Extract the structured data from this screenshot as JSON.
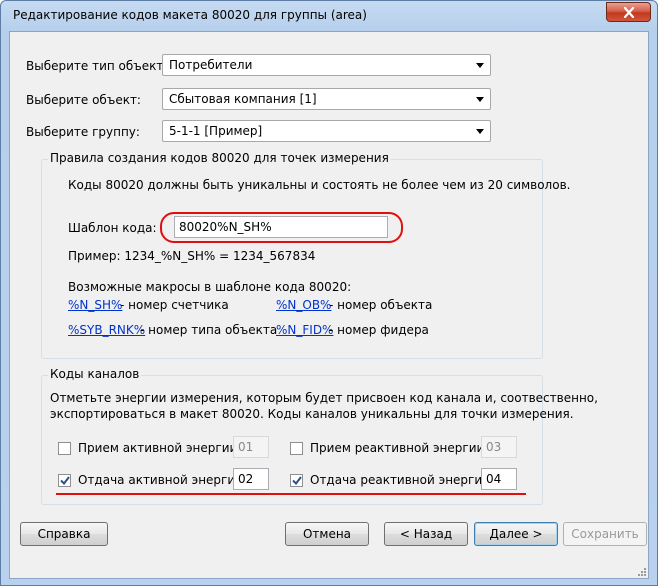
{
  "window": {
    "title": "Редактирование кодов макета 80020 для группы (area)"
  },
  "selectors": {
    "object_type": {
      "label": "Выберите тип объекта:",
      "value": "Потребители"
    },
    "object": {
      "label": "Выберите объект:",
      "value": "Сбытовая компания [1]"
    },
    "group": {
      "label": "Выберите группу:",
      "value": "5-1-1 [Пример]"
    }
  },
  "rules": {
    "title": "Правила создания кодов 80020 для точек измерения",
    "note": "Коды 80020 должны быть уникальны и состоять не более чем из 20 символов.",
    "template_label": "Шаблон кода:",
    "template_value": "80020%N_SH%",
    "example": "Пример: 1234_%N_SH% = 1234_567834",
    "macros_title": "Возможные макросы в шаблоне кода 80020:",
    "macros": [
      {
        "code": "%N_SH%",
        "desc": "- номер счетчика"
      },
      {
        "code": "%N_OB%",
        "desc": "- номер объекта"
      },
      {
        "code": "%SYB_RNK%",
        "desc": "- номер типа объекта"
      },
      {
        "code": "%N_FID%",
        "desc": "- номер фидера"
      }
    ]
  },
  "channels": {
    "title": "Коды каналов",
    "note1": "Отметьте энергии измерения, которым будет присвоен код канала и, соотвественно,",
    "note2": "экспортироваться в макет 80020. Коды каналов уникальны для точки измерения.",
    "items": [
      {
        "label": "Прием активной энергии:",
        "checked": false,
        "value": "01"
      },
      {
        "label": "Прием реактивной энергии:",
        "checked": false,
        "value": "03"
      },
      {
        "label": "Отдача активной энергии:",
        "checked": true,
        "value": "02"
      },
      {
        "label": "Отдача реактивной энергии:",
        "checked": true,
        "value": "04"
      }
    ]
  },
  "buttons": {
    "help": "Справка",
    "cancel": "Отмена",
    "back": "< Назад",
    "next": "Далее >",
    "save": "Сохранить"
  },
  "colors": {
    "link": "#0033cc",
    "annotation": "#e01010"
  }
}
